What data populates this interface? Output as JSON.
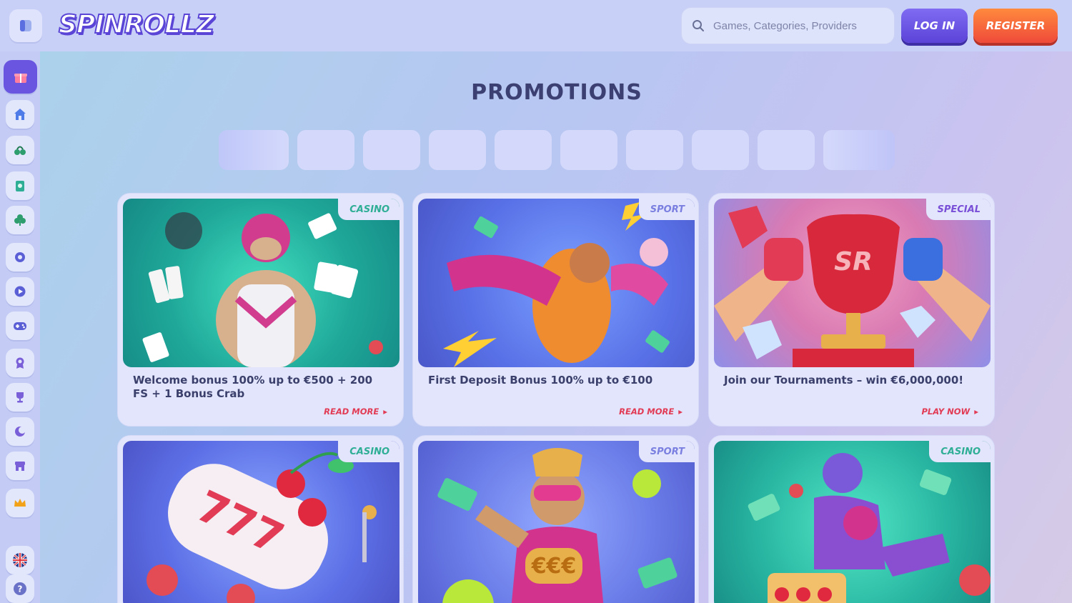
{
  "header": {
    "logo": "SPINROLLZ",
    "search_placeholder": "Games, Categories, Providers",
    "login_label": "LOG IN",
    "register_label": "REGISTER"
  },
  "sidebar": {
    "items": [
      {
        "name": "gift-icon",
        "color": "#ffffff",
        "active": true
      },
      {
        "name": "home-icon",
        "color": "#4f7be8"
      },
      {
        "name": "cherries-icon",
        "color": "#2f9e6f"
      },
      {
        "name": "cards-icon",
        "color": "#2fae96"
      },
      {
        "name": "clover-icon",
        "color": "#2f9e6f"
      },
      {
        "name": "soccer-icon",
        "color": "#5b5fd6"
      },
      {
        "name": "play-icon",
        "color": "#5b5fd6"
      },
      {
        "name": "gamepad-icon",
        "color": "#5b5fd6"
      },
      {
        "name": "award-icon",
        "color": "#7a60d8"
      },
      {
        "name": "trophy-icon",
        "color": "#7a60d8"
      },
      {
        "name": "moon-icon",
        "color": "#7a60d8"
      },
      {
        "name": "shop-icon",
        "color": "#7a60d8"
      },
      {
        "name": "crown-icon",
        "color": "#f2a219"
      }
    ],
    "language_icon": "uk-flag-icon",
    "help_icon": "help-icon"
  },
  "main": {
    "title": "PROMOTIONS",
    "promotions": [
      {
        "tag": "CASINO",
        "tag_type": "casino",
        "text": "Welcome bonus 100% up to €500 + 200 FS + 1 Bonus Crab",
        "link": "READ MORE"
      },
      {
        "tag": "SPORT",
        "tag_type": "sport",
        "text": "First Deposit Bonus 100% up to €100",
        "link": "READ MORE"
      },
      {
        "tag": "SPECIAL",
        "tag_type": "special",
        "text": "Join our Tournaments – win €6,000,000!",
        "link": "PLAY NOW"
      },
      {
        "tag": "CASINO",
        "tag_type": "casino"
      },
      {
        "tag": "SPORT",
        "tag_type": "sport"
      },
      {
        "tag": "CASINO",
        "tag_type": "casino"
      }
    ]
  },
  "colors": {
    "accent": "#5b43d8",
    "register": "#ef4a3a",
    "link": "#e23b55"
  }
}
